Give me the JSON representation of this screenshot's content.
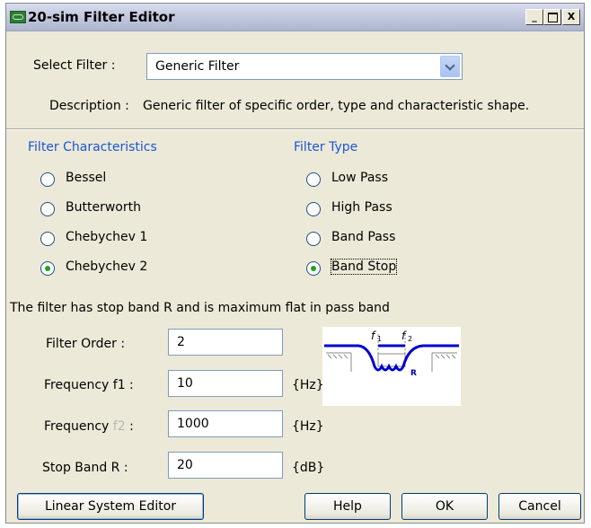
{
  "window": {
    "title": "20-sim Filter Editor",
    "minimize": "_",
    "maximize": "□",
    "close": "X"
  },
  "select_filter": {
    "label": "Select Filter :",
    "value": "Generic Filter"
  },
  "description": {
    "label": "Description :",
    "text": "Generic filter of specific order, type and characteristic shape."
  },
  "characteristics": {
    "heading": "Filter Characteristics",
    "options": [
      "Bessel",
      "Butterworth",
      "Chebychev 1",
      "Chebychev 2"
    ],
    "selected": "Chebychev 2"
  },
  "filter_type": {
    "heading": "Filter Type",
    "options": [
      "Low Pass",
      "High Pass",
      "Band Pass",
      "Band Stop"
    ],
    "selected": "Band Stop"
  },
  "info_text": "The filter has stop band R and is maximum flat in pass band",
  "params": {
    "order": {
      "label": "Filter Order :",
      "value": "2"
    },
    "f1": {
      "label": "Frequency f1 :",
      "value": "10",
      "unit": "{Hz}"
    },
    "f2": {
      "label_prefix": "Frequency ",
      "label_dim": "f2",
      "label_suffix": " :",
      "value": "1000",
      "unit": "{Hz}"
    },
    "stopband": {
      "label": "Stop Band R :",
      "value": "20",
      "unit": "{dB}"
    }
  },
  "diagram": {
    "f1_label": "f",
    "f1_sub": "1",
    "f2_label": "f",
    "f2_sub": "2",
    "r_label": "R"
  },
  "buttons": {
    "linear_system_editor": "Linear System Editor",
    "help": "Help",
    "ok": "OK",
    "cancel": "Cancel"
  },
  "colors": {
    "accent_blue": "#1a55d6",
    "radio_selected": "#21a121"
  }
}
